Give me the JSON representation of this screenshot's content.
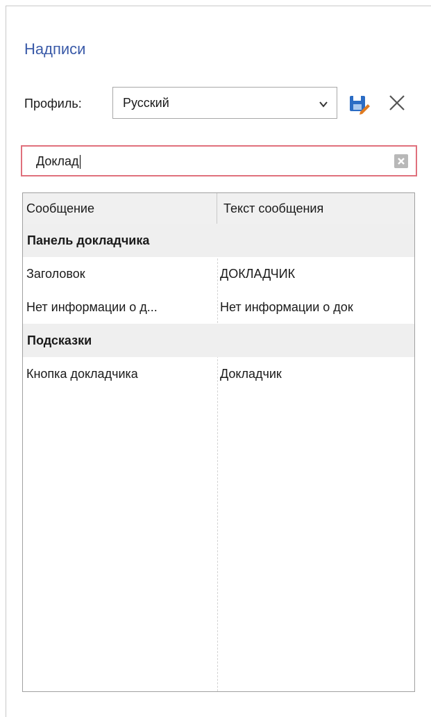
{
  "panel": {
    "title": "Надписи"
  },
  "profile": {
    "label": "Профиль:",
    "selected": "Русский"
  },
  "search": {
    "value": "Доклад"
  },
  "icons": {
    "save": "save-icon",
    "delete": "close-icon",
    "dropdown": "chevron-down-icon",
    "clear": "clear-icon"
  },
  "colors": {
    "title": "#3a5aa8",
    "search_border": "#e0707c",
    "save_icon_blue": "#2b6cc4",
    "save_icon_orange": "#e07b20"
  },
  "grid": {
    "columns": [
      "Сообщение",
      "Текст сообщения"
    ],
    "groups": [
      {
        "name": "Панель докладчика",
        "rows": [
          [
            "Заголовок",
            "ДОКЛАДЧИК"
          ],
          [
            "Нет информации о д...",
            "Нет информации о док"
          ]
        ]
      },
      {
        "name": "Подсказки",
        "rows": [
          [
            "Кнопка докладчика",
            "Докладчик"
          ]
        ]
      }
    ]
  }
}
